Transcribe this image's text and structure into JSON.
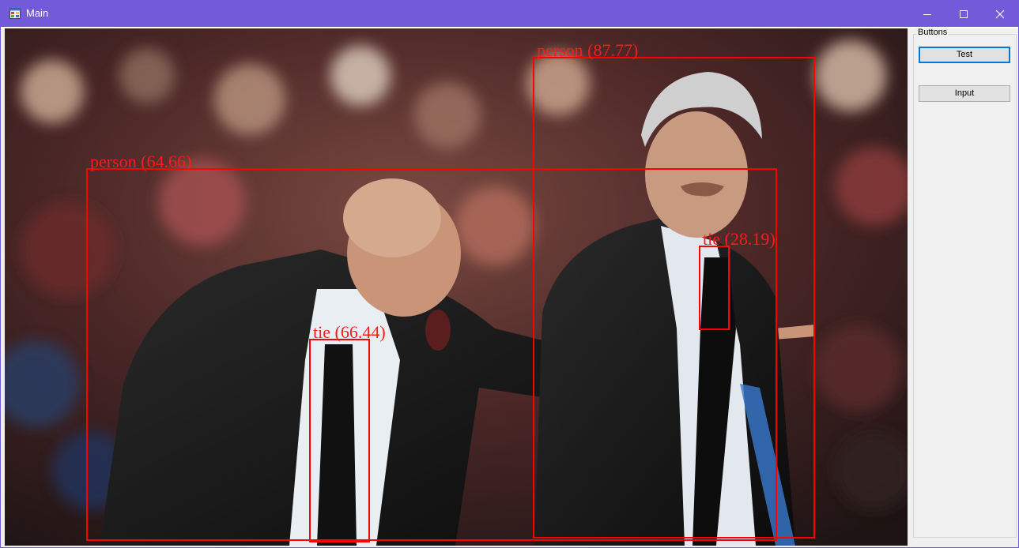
{
  "window": {
    "title": "Main",
    "controls": {
      "minimize": "minimize-icon",
      "maximize": "maximize-icon",
      "close": "close-icon"
    }
  },
  "detections": [
    {
      "label": "person (87.77)",
      "class": "person",
      "score": 87.77
    },
    {
      "label": "person (64.66)",
      "class": "person",
      "score": 64.66
    },
    {
      "label": "tie (28.19)",
      "class": "tie",
      "score": 28.19
    },
    {
      "label": "tie (66.44)",
      "class": "tie",
      "score": 66.44
    }
  ],
  "sidebar": {
    "group_title": "Buttons",
    "buttons": {
      "test": "Test",
      "input": "Input"
    }
  },
  "colors": {
    "titlebar": "#735ad8",
    "box": "#ff0000",
    "focus": "#0078d7"
  }
}
